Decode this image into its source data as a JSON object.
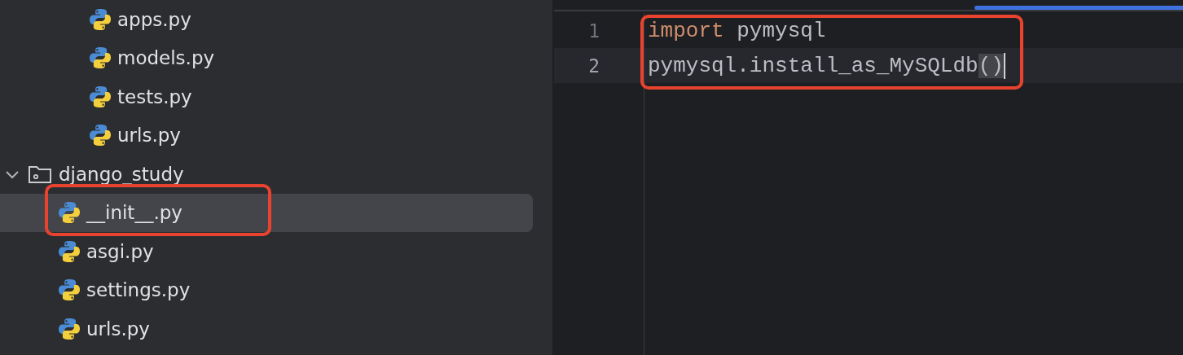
{
  "project_tree": [
    {
      "kind": "hidden",
      "children": [
        {
          "kind": "hidden",
          "children": [
            {
              "kind": "python-file",
              "label": "apps.py",
              "selected": false
            },
            {
              "kind": "python-file",
              "label": "models.py",
              "selected": false
            },
            {
              "kind": "python-file",
              "label": "tests.py",
              "selected": false
            },
            {
              "kind": "python-file",
              "label": "urls.py",
              "selected": false
            }
          ]
        }
      ]
    },
    {
      "kind": "package",
      "label": "django_study",
      "expanded": true,
      "children": [
        {
          "kind": "python-file",
          "label": "__init__.py",
          "selected": true
        },
        {
          "kind": "python-file",
          "label": "asgi.py",
          "selected": false
        },
        {
          "kind": "python-file",
          "label": "settings.py",
          "selected": false
        },
        {
          "kind": "python-file",
          "label": "urls.py",
          "selected": false
        }
      ]
    }
  ],
  "editor": {
    "lines": [
      {
        "number": "1",
        "current": false,
        "tokens": [
          {
            "kind": "keyword",
            "text": "import"
          },
          {
            "kind": "plain",
            "text": " pymysql"
          }
        ]
      },
      {
        "number": "2",
        "current": true,
        "tokens": [
          {
            "kind": "plain",
            "text": "pymysql.install_as_MySQLdb"
          },
          {
            "kind": "bracket-match",
            "text": "()"
          }
        ]
      }
    ]
  }
}
